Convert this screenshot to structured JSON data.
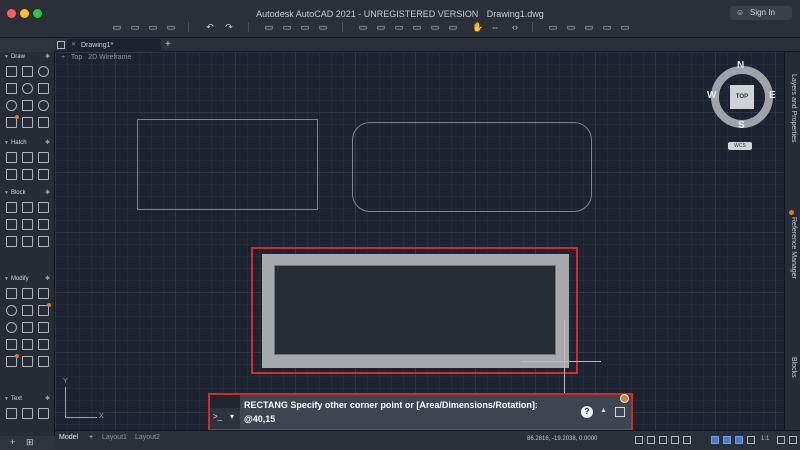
{
  "window": {
    "title": [
      "Autodesk AutoCAD 2021 - UNREGISTERED VERSION",
      "Drawing1.dwg"
    ],
    "traffic_colors": [
      "#fd5f57",
      "#febc2e",
      "#28c840"
    ],
    "sign_in_label": "Sign In"
  },
  "tabs": {
    "items": [
      {
        "label": "Drawing1*"
      }
    ],
    "add_icon": "plus-icon"
  },
  "viewport": {
    "controls": [
      "Top",
      "2D Wireframe"
    ],
    "ucs_x": "X",
    "ucs_y": "Y"
  },
  "viewcube": {
    "n": "N",
    "s": "S",
    "e": "E",
    "w": "W",
    "face": "TOP",
    "wcs": "WCS"
  },
  "palette": {
    "sections": [
      {
        "label": "Draw"
      },
      {
        "label": "Hatch"
      },
      {
        "label": "Block"
      },
      {
        "label": "Modify"
      },
      {
        "label": "Text"
      }
    ]
  },
  "right_panel": {
    "items": [
      {
        "label": "Layers and Properties"
      },
      {
        "label": "Reference Manager"
      },
      {
        "label": "Blocks"
      }
    ]
  },
  "command": {
    "prompt_symbol": ">_",
    "line1": "RECTANG Specify other corner point or [Area/Dimensions/Rotation]:",
    "line2": "@40,15",
    "help_symbol": "?"
  },
  "status": {
    "layout_tabs": [
      "Model",
      "Layout1",
      "Layout2"
    ],
    "coords": "86.2816, -19.2038, 0.0000",
    "scale": "1:1"
  },
  "colors": {
    "highlight": "#d8262a",
    "accent_dot": "#e07a2e"
  }
}
